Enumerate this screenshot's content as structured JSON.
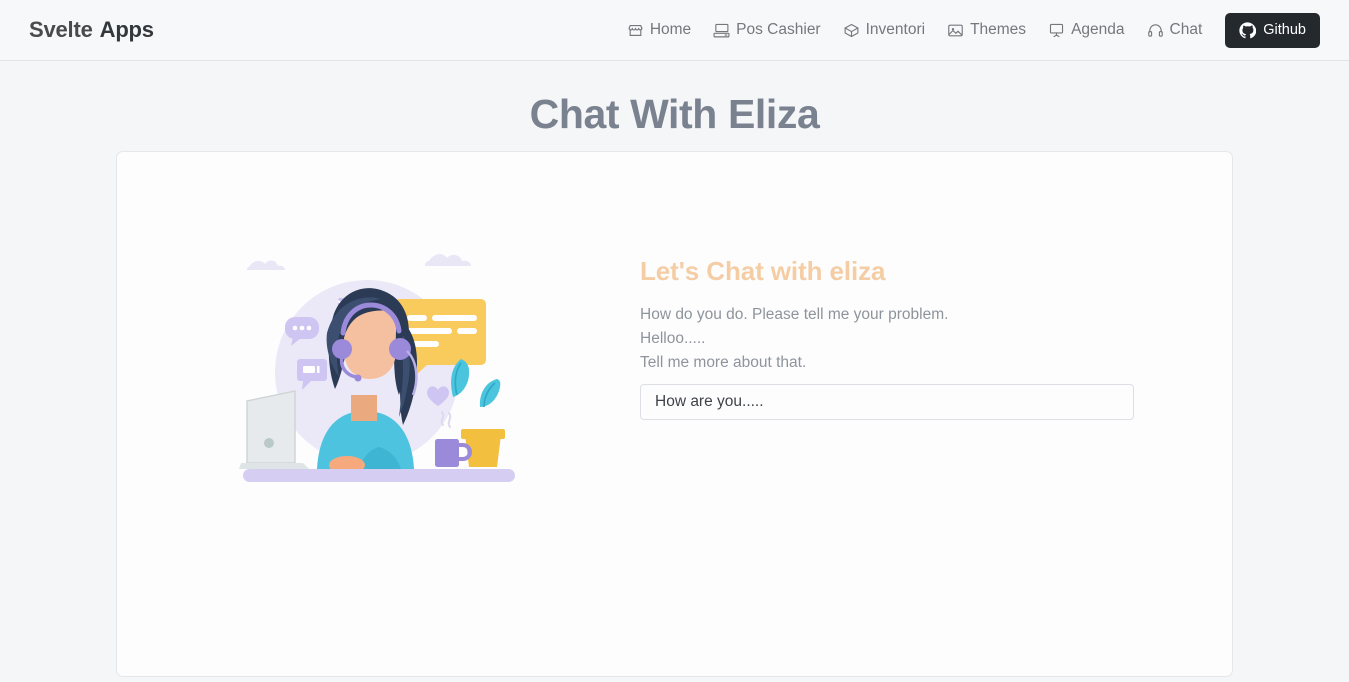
{
  "brand": {
    "first": "Svelte",
    "second": "Apps",
    "first_color": "#f5ceaa",
    "second_color": "#33383d"
  },
  "nav": {
    "items": [
      {
        "label": "Home",
        "icon": "storefront-icon"
      },
      {
        "label": "Pos Cashier",
        "icon": "desktop-computer-icon"
      },
      {
        "label": "Inventori",
        "icon": "box-package-icon"
      },
      {
        "label": "Themes",
        "icon": "image-picture-icon"
      },
      {
        "label": "Agenda",
        "icon": "presentation-board-icon"
      },
      {
        "label": "Chat",
        "icon": "headset-icon"
      }
    ],
    "github": {
      "label": "Github",
      "icon": "github-icon",
      "bg": "#24292e",
      "fg": "#ffffff"
    }
  },
  "page": {
    "title": "Chat With Eliza",
    "title_color": "#7a8290",
    "background": "#f5f6f8"
  },
  "chat": {
    "heading": "Let's Chat with eliza",
    "heading_color": "#f5cda4",
    "messages": [
      "How do you do. Please tell me your problem.",
      "Helloo.....",
      "Tell me more about that."
    ],
    "input": {
      "value": "How are you.....",
      "placeholder": "How are you....."
    }
  },
  "illustration": {
    "name": "customer-support-agent-illustration",
    "alt": "Woman with headset working at laptop with chat bubbles, plant and mug",
    "colors": {
      "circle_backdrop": "#ebe8f7",
      "hair": "#2b3a55",
      "skin": "#f5c0a0",
      "shirt": "#4ec3e0",
      "headset": "#9b8ada",
      "speech_bubble": "#f8cb5c",
      "plant": "#4bc4de",
      "pot": "#f2bf3f",
      "mug": "#9b8ada",
      "desk": "#d6cdf2",
      "laptop": "#e7eaec"
    }
  }
}
